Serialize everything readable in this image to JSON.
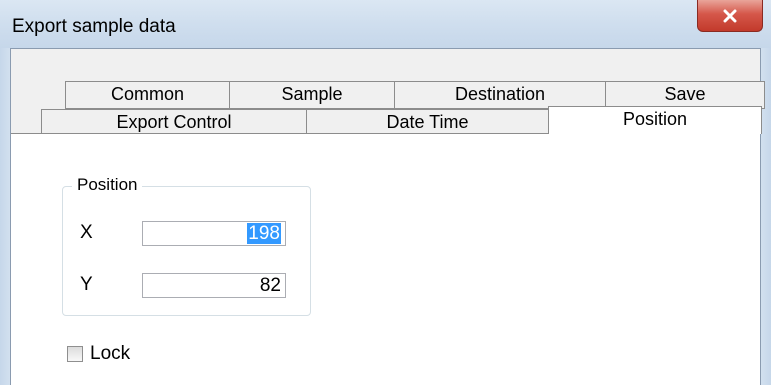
{
  "window": {
    "title": "Export sample data"
  },
  "tabs_back": [
    "Common",
    "Sample",
    "Destination",
    "Save"
  ],
  "tabs_front": [
    "Export Control",
    "Date Time",
    "Position"
  ],
  "position_group": {
    "title": "Position",
    "x_label": "X",
    "x_value": "198",
    "y_label": "Y",
    "y_value": "82"
  },
  "lock": {
    "label": "Lock",
    "checked": false
  },
  "colors": {
    "titlebar": "#cfdeee",
    "close": "#c94536",
    "selection": "#3399ff"
  },
  "icons": {
    "close": "close-icon"
  }
}
